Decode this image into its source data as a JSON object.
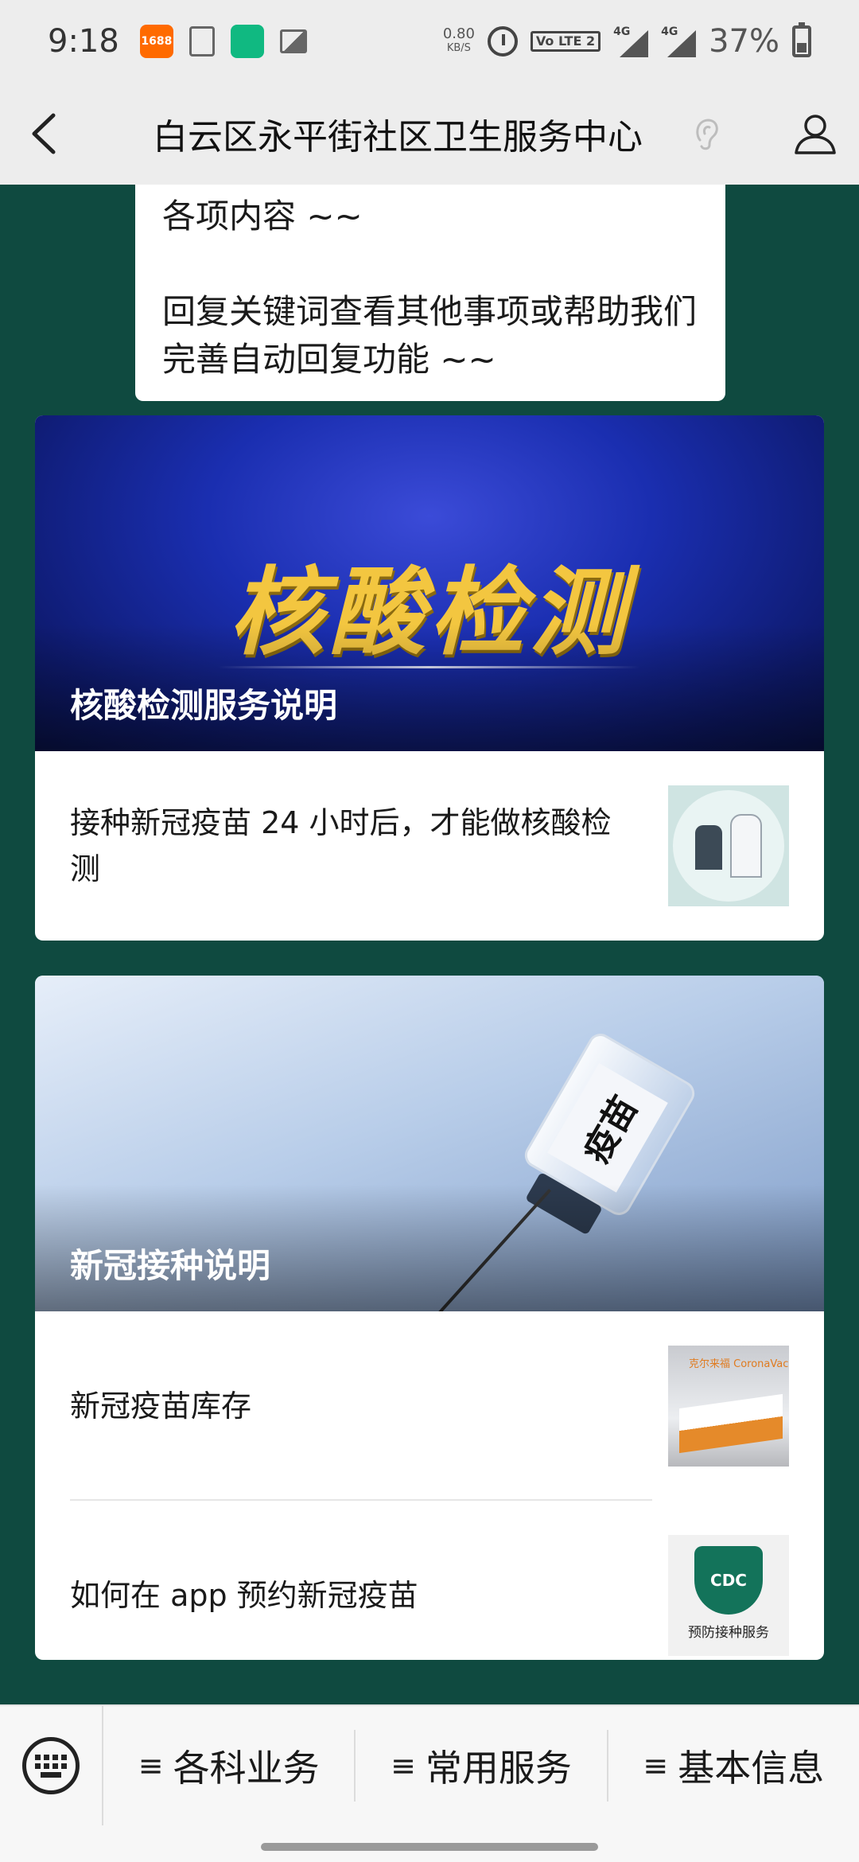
{
  "status_bar": {
    "time": "9:18",
    "app_alibaba": "1688",
    "net_speed_value": "0.80",
    "net_speed_unit": "KB/S",
    "volte": "Vo LTE 2",
    "signal1": "4G",
    "signal2": "4G",
    "battery": "37%"
  },
  "header": {
    "title": "白云区永平街社区卫生服务中心"
  },
  "message": {
    "line1": "各项内容 ~~",
    "line2": "回复关键词查看其他事项或帮助我们完善自动回复功能 ~~"
  },
  "cards": [
    {
      "banner_text": "核酸检测",
      "banner_caption": "核酸检测服务说明",
      "items": [
        {
          "text": "接种新冠疫苗 24 小时后，才能做核酸检测"
        }
      ]
    },
    {
      "banner_vial_label": "疫苗",
      "banner_caption": "新冠接种说明",
      "items": [
        {
          "text": "新冠疫苗库存",
          "thumb_logo": "克尔来福 CoronaVac"
        },
        {
          "text": "如何在 app 预约新冠疫苗",
          "thumb_logo": "CDC",
          "thumb_caption": "预防接种服务"
        }
      ]
    }
  ],
  "bottom_menu": {
    "items": [
      {
        "label": "各科业务"
      },
      {
        "label": "常用服务"
      },
      {
        "label": "基本信息"
      }
    ]
  },
  "colors": {
    "chat_background": "#0f4a40",
    "bar_background": "#ededed",
    "accent_gold": "#f3c640"
  }
}
